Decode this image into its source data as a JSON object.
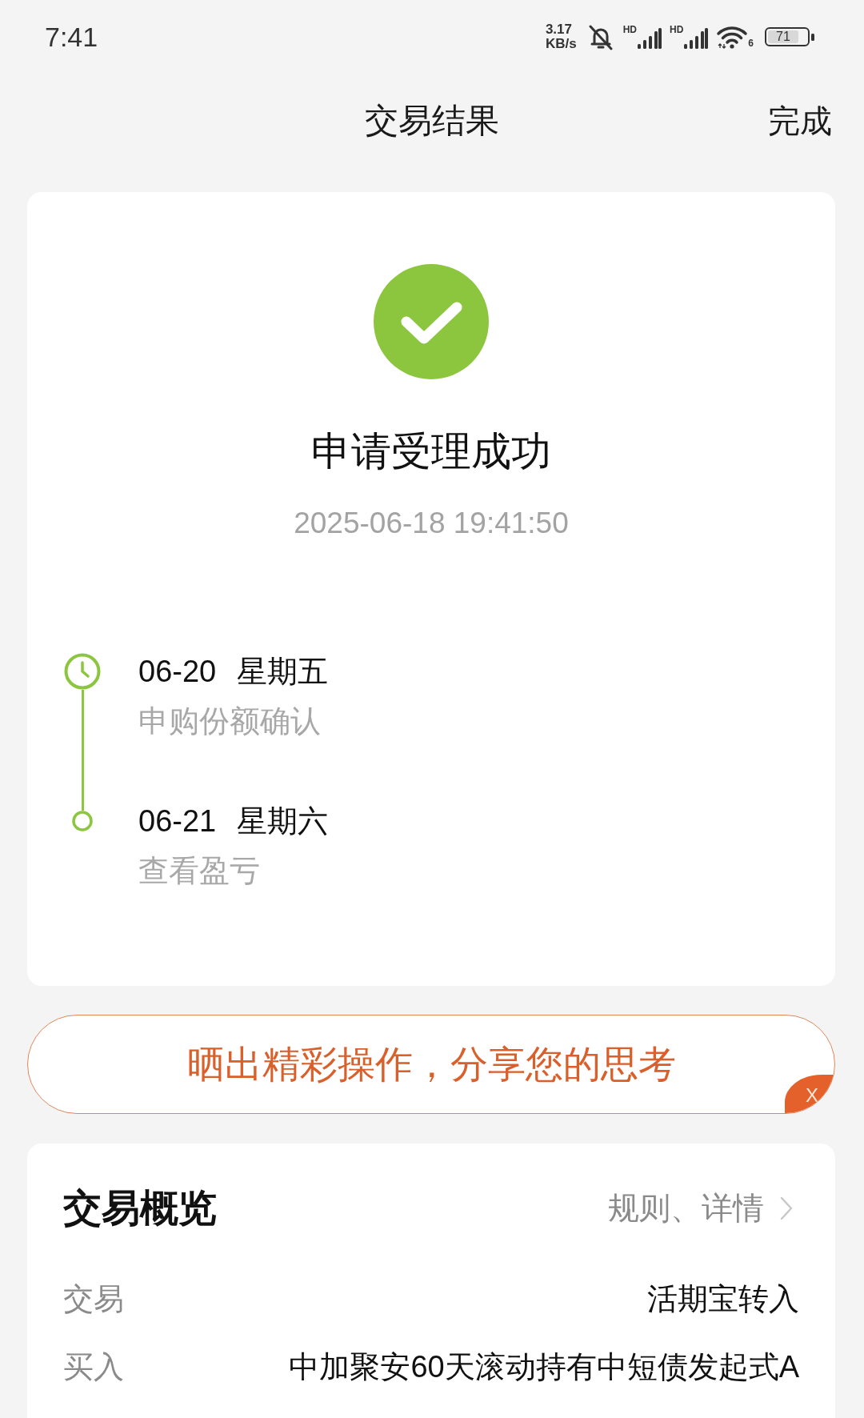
{
  "status_bar": {
    "time": "7:41",
    "net_speed": [
      "3.17",
      "KB/s"
    ],
    "signals": [
      {
        "label": "HD"
      },
      {
        "label": "HD"
      }
    ],
    "wifi_label": "6",
    "battery": "71"
  },
  "header": {
    "title": "交易结果",
    "done": "完成"
  },
  "result": {
    "title": "申请受理成功",
    "datetime": "2025-06-18 19:41:50"
  },
  "timeline": [
    {
      "kind": "clock",
      "date": "06-20",
      "weekday": "星期五",
      "desc": "申购份额确认"
    },
    {
      "kind": "dot",
      "date": "06-21",
      "weekday": "星期六",
      "desc": "查看盈亏"
    }
  ],
  "share_banner": {
    "text": "晒出精彩操作，分享您的思考",
    "close": "X"
  },
  "overview": {
    "title": "交易概览",
    "link": "规则、详情",
    "rows": [
      {
        "label": "交易",
        "value": "活期宝转入"
      },
      {
        "label": "买入",
        "value": "中加聚安60天滚动持有中短债发起式A"
      }
    ]
  }
}
